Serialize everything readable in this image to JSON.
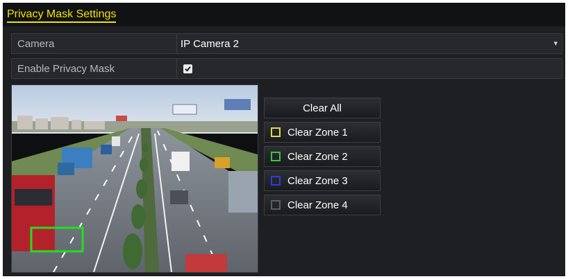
{
  "window": {
    "title": "Privacy Mask Settings"
  },
  "camera": {
    "label": "Camera",
    "value": "IP Camera 2",
    "icon": "chevron-down-icon"
  },
  "enable_mask": {
    "label": "Enable Privacy Mask",
    "checked": true,
    "icon": "checkmark-icon"
  },
  "preview": {
    "mask_zone_color": "#22dd22"
  },
  "buttons": {
    "clear_all": "Clear All",
    "zones": [
      {
        "label": "Clear Zone 1",
        "color": "#e0d84a"
      },
      {
        "label": "Clear Zone 2",
        "color": "#3ec43e"
      },
      {
        "label": "Clear Zone 3",
        "color": "#2b3fd6"
      },
      {
        "label": "Clear Zone 4",
        "color": "#5a5d62"
      }
    ]
  }
}
